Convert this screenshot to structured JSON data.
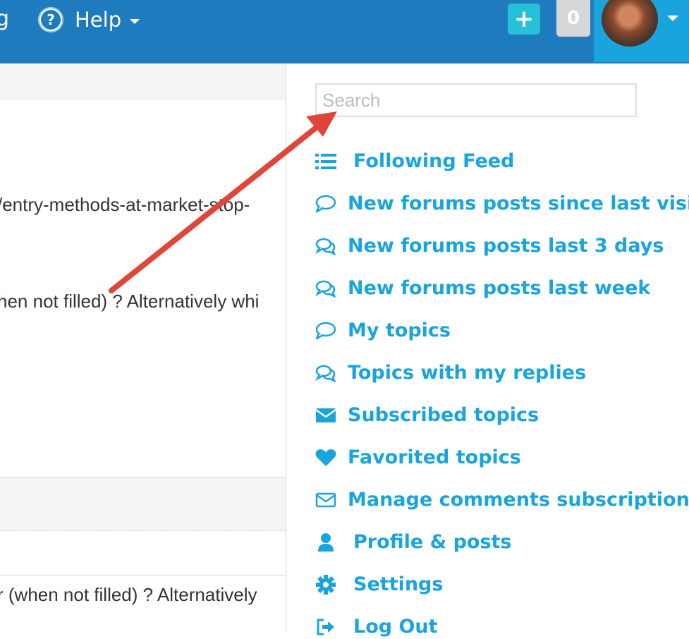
{
  "topbar": {
    "cut_text": "g",
    "help_label": "Help",
    "count": "0",
    "add_label": "+"
  },
  "background": {
    "line1": "/entry-methods-at-market-stop-",
    "line2": "hen not filled) ? Alternatively whi",
    "line3": "r (when not filled) ? Alternatively"
  },
  "menu": {
    "search_placeholder": "Search",
    "items": [
      {
        "label": "Following Feed",
        "icon": "list-icon"
      },
      {
        "label": "New forums posts since last visit",
        "icon": "comment-icon"
      },
      {
        "label": "New forums posts last 3 days",
        "icon": "comments-icon"
      },
      {
        "label": "New forums posts last week",
        "icon": "comments-icon"
      },
      {
        "label": "My topics",
        "icon": "comment-icon"
      },
      {
        "label": "Topics with my replies",
        "icon": "comments-icon"
      },
      {
        "label": "Subscribed topics",
        "icon": "envelope-icon"
      },
      {
        "label": "Favorited topics",
        "icon": "heart-icon"
      },
      {
        "label": "Manage comments subscriptions",
        "icon": "envelope-outline-icon"
      },
      {
        "label": "Profile & posts",
        "icon": "user-icon"
      },
      {
        "label": "Settings",
        "icon": "gear-icon"
      },
      {
        "label": "Log Out",
        "icon": "sign-out-icon"
      }
    ]
  },
  "colors": {
    "topbar": "#1e7bbd",
    "accent": "#1aa4dd",
    "add_button": "#27c0d8",
    "annotation_arrow": "#e0453a"
  }
}
